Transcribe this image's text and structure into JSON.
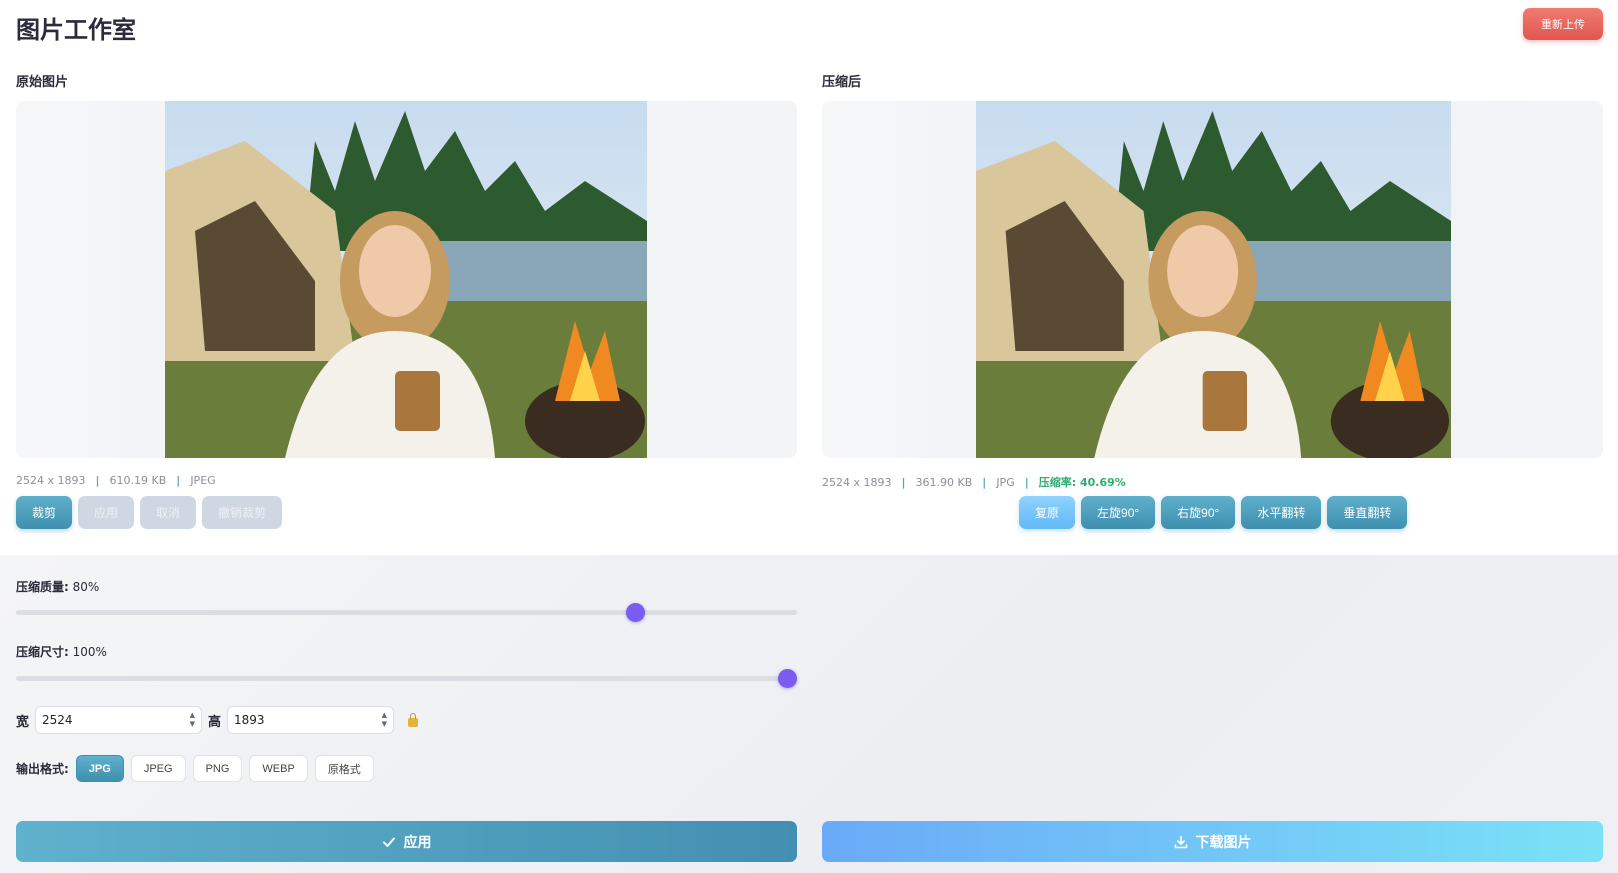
{
  "app": {
    "title": "图片工作室",
    "reupload_label": "重新上传"
  },
  "original": {
    "label": "原始图片",
    "dimensions": "2524 x 1893",
    "size": "610.19 KB",
    "format": "JPEG",
    "buttons": {
      "crop": "裁剪",
      "apply": "应用",
      "cancel": "取消",
      "undo_crop": "撤销裁剪"
    }
  },
  "compressed": {
    "label": "压缩后",
    "dimensions": "2524 x 1893",
    "size": "361.90 KB",
    "format": "JPG",
    "ratio": "压缩率: 40.69%",
    "buttons": {
      "restore": "复原",
      "rotate_left": "左旋90°",
      "rotate_right": "右旋90°",
      "flip_h": "水平翻转",
      "flip_v": "垂直翻转"
    }
  },
  "settings": {
    "quality": {
      "label": "压缩质量:",
      "value_text": "80%",
      "value": 80
    },
    "size": {
      "label": "压缩尺寸:",
      "value_text": "100%",
      "value": 100
    },
    "width_label": "宽",
    "width_value": "2524",
    "height_label": "高",
    "height_value": "1893",
    "format_label": "输出格式:",
    "formats": [
      "JPG",
      "JPEG",
      "PNG",
      "WEBP",
      "原格式"
    ],
    "selected_format": "JPG"
  },
  "actions": {
    "apply": "应用",
    "download": "下载图片"
  },
  "colors": {
    "accent": "#4a9abb",
    "slider_thumb": "#7b5cf0",
    "danger": "#e0574f",
    "ratio_green": "#2fae6f"
  },
  "icons": {
    "lock": "lock-icon",
    "check": "check-icon",
    "download": "download-icon"
  }
}
